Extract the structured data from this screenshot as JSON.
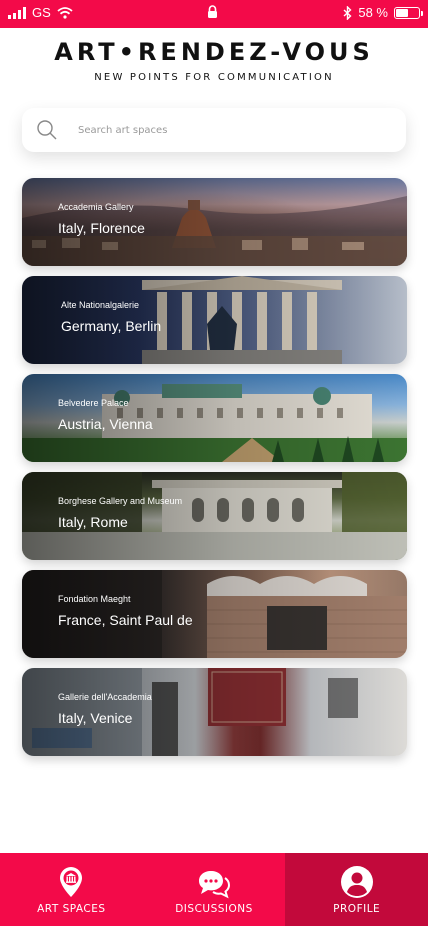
{
  "status_bar": {
    "carrier": "GS",
    "battery_percent": "58 %",
    "battery_level": 0.58,
    "icons": [
      "signal-icon",
      "wifi-icon",
      "lock-icon",
      "bluetooth-icon",
      "battery-icon"
    ]
  },
  "header": {
    "title": "ART•RENDEZ-VOUS",
    "subtitle": "NEW POINTS FOR COMMUNICATION"
  },
  "search": {
    "placeholder": "Search art spaces",
    "value": "",
    "icon": "search-icon"
  },
  "spaces": [
    {
      "gallery": "Accademia Gallery",
      "location": "Italy, Florence"
    },
    {
      "gallery": "Alte Nationalgalerie",
      "location": "Germany, Berlin"
    },
    {
      "gallery": "Belvedere Palace",
      "location": "Austria, Vienna"
    },
    {
      "gallery": "Borghese Gallery and Museum",
      "location": "Italy, Rome"
    },
    {
      "gallery": "Fondation Maeght",
      "location": "France, Saint Paul de"
    },
    {
      "gallery": "Gallerie dell'Accademia",
      "location": "Italy, Venice"
    }
  ],
  "bottom_nav": {
    "items": [
      {
        "label": "ART SPACES",
        "icon": "gallery-pin-icon",
        "active": false
      },
      {
        "label": "DISCUSSIONS",
        "icon": "chat-bubbles-icon",
        "active": false
      },
      {
        "label": "PROFILE",
        "icon": "user-avatar-icon",
        "active": true
      }
    ]
  },
  "colors": {
    "accent": "#f30a49",
    "accent_dark": "#c2093b",
    "background": "#ffffff",
    "text": "#111111"
  }
}
